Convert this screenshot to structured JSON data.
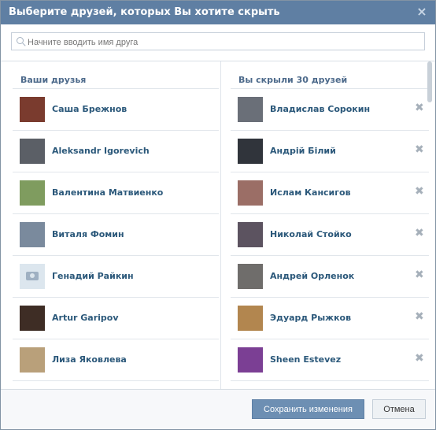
{
  "dialog": {
    "title": "Выберите друзей, которых Вы хотите скрыть",
    "close_label": "×"
  },
  "search": {
    "placeholder": "Начните вводить имя друга",
    "value": ""
  },
  "left": {
    "header": "Ваши друзья",
    "items": [
      {
        "name": "Саша Брежнов",
        "avatar_color": "#7a3b2e"
      },
      {
        "name": "Aleksandr Igorevich",
        "avatar_color": "#5b5f66"
      },
      {
        "name": "Валентина Матвиенко",
        "avatar_color": "#7f9c5f"
      },
      {
        "name": "Виталя Фомин",
        "avatar_color": "#7a8a9d"
      },
      {
        "name": "Генадий Райкин",
        "avatar_color": "#dce6ee"
      },
      {
        "name": "Artur Garipov",
        "avatar_color": "#3e2d25"
      },
      {
        "name": "Лиза Яковлева",
        "avatar_color": "#b9a07a"
      },
      {
        "name": "",
        "avatar_color": "#9a7d68"
      }
    ]
  },
  "right": {
    "header": "Вы скрыли 30 друзей",
    "remove_symbol": "✖",
    "items": [
      {
        "name": "Владислав Сорокин",
        "avatar_color": "#6a6f78"
      },
      {
        "name": "Андрій Білий",
        "avatar_color": "#30343b"
      },
      {
        "name": "Ислам Кансигов",
        "avatar_color": "#9b6e66"
      },
      {
        "name": "Николай Стойко",
        "avatar_color": "#5c5360"
      },
      {
        "name": "Андрей Орленок",
        "avatar_color": "#6f6d6b"
      },
      {
        "name": "Эдуард Рыжков",
        "avatar_color": "#b2864f"
      },
      {
        "name": "Sheen Estevez",
        "avatar_color": "#7b3f94"
      },
      {
        "name": "",
        "avatar_color": "#78665b"
      }
    ]
  },
  "footer": {
    "save_label": "Сохранить изменения",
    "cancel_label": "Отмена"
  }
}
